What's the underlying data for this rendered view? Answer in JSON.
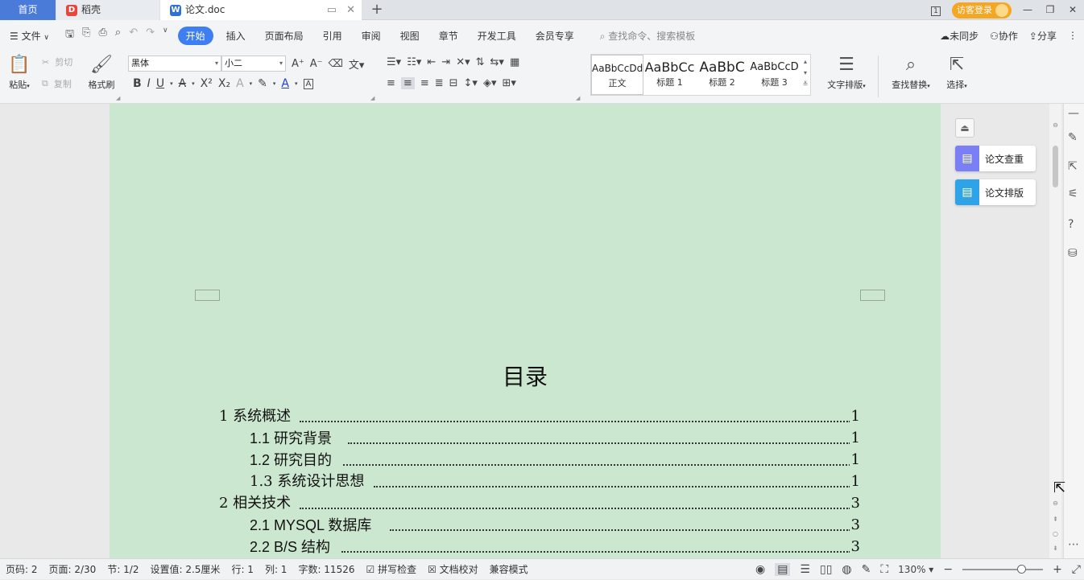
{
  "tabs": {
    "home": "首页",
    "daoke": "稻壳",
    "doc": "论文.doc",
    "add": "+"
  },
  "titlebar": {
    "visitor_login": "访客登录",
    "page_count_badge": "1"
  },
  "menu": {
    "file": "文件",
    "items": [
      "开始",
      "插入",
      "页面布局",
      "引用",
      "审阅",
      "视图",
      "章节",
      "开发工具",
      "会员专享"
    ],
    "search_placeholder": "查找命令、搜索模板",
    "unsynced": "未同步",
    "collab": "协作",
    "share": "分享"
  },
  "ribbon": {
    "paste": "粘贴",
    "cut": "剪切",
    "copy": "复制",
    "format_painter": "格式刷",
    "font_family": "黑体",
    "font_size": "小二",
    "styles": [
      {
        "sample": "AaBbCcDd",
        "name": "正文"
      },
      {
        "sample": "AaBbCc",
        "name": "标题 1"
      },
      {
        "sample": "AaBbC",
        "name": "标题 2"
      },
      {
        "sample": "AaBbCcD",
        "name": "标题 3"
      }
    ],
    "text_layout": "文字排版",
    "find_replace": "查找替换",
    "select": "选择"
  },
  "document": {
    "toc_title": "目录",
    "toc": [
      {
        "text": "1 系统概述",
        "page": "1",
        "level": 1
      },
      {
        "text": "1.1  研究背景",
        "page": "1",
        "level": 2
      },
      {
        "text": "1.2 研究目的",
        "page": "1",
        "level": 2
      },
      {
        "text": "1.3 系统设计思想",
        "page": "1",
        "level": 2
      },
      {
        "text": "2 相关技术",
        "page": "3",
        "level": 1
      },
      {
        "text": "2.1 MYSQL 数据库",
        "page": "3",
        "level": 2
      },
      {
        "text": "2.2 B/S 结构",
        "page": "3",
        "level": 2
      }
    ]
  },
  "floatpanel": {
    "plagiarism_check": "论文查重",
    "paper_format": "论文排版"
  },
  "status": {
    "page_num": "页码: 2",
    "page_of": "页面: 2/30",
    "section": "节: 1/2",
    "setting": "设置值: 2.5厘米",
    "row": "行: 1",
    "col": "列: 1",
    "word_count": "字数: 11526",
    "spell_check": "拼写检查",
    "doc_proof": "文档校对",
    "compat_mode": "兼容模式",
    "zoom": "130%"
  },
  "colors": {
    "accent": "#3f7ef0",
    "page_bg": "#cce7cf",
    "visitor": "#f5a623"
  }
}
